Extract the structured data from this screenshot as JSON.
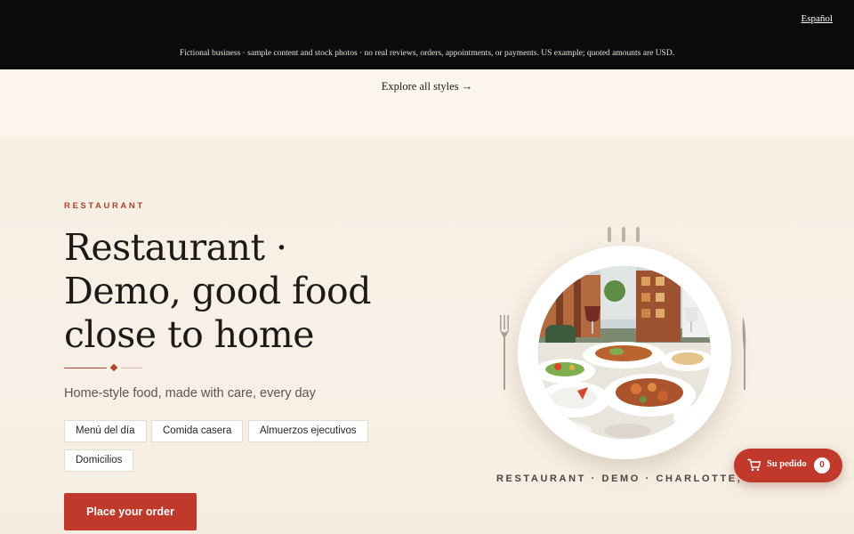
{
  "topbar": {
    "language_link": "Español",
    "disclaimer": "Fictional business · sample content and stock photos · no real reviews, orders, appointments, or payments. US example; quoted amounts are USD."
  },
  "explore_link": "Explore all styles →",
  "hero": {
    "eyebrow": "RESTAURANT",
    "headline_lines": [
      "Restaurant ·",
      "Demo, good food",
      "close to home"
    ],
    "tagline": "Home-style food, made with care, every day",
    "chips": [
      "Menú del día",
      "Comida casera",
      "Almuerzos ejecutivos",
      "Domicilios"
    ],
    "cta_label": "Place your order"
  },
  "illustration": {
    "icons": [
      "steam-icon",
      "fork-icon",
      "knife-icon"
    ],
    "photo": "restaurant-dining-table-photo",
    "caption": "RESTAURANT · DEMO · CHARLOTTE, NC"
  },
  "cart": {
    "icon": "cart-icon",
    "label": "Su pedido",
    "count": "0"
  },
  "colors": {
    "accent": "#c0392b",
    "topbar": "#0b0b0b",
    "background": "#fbf5ec"
  }
}
